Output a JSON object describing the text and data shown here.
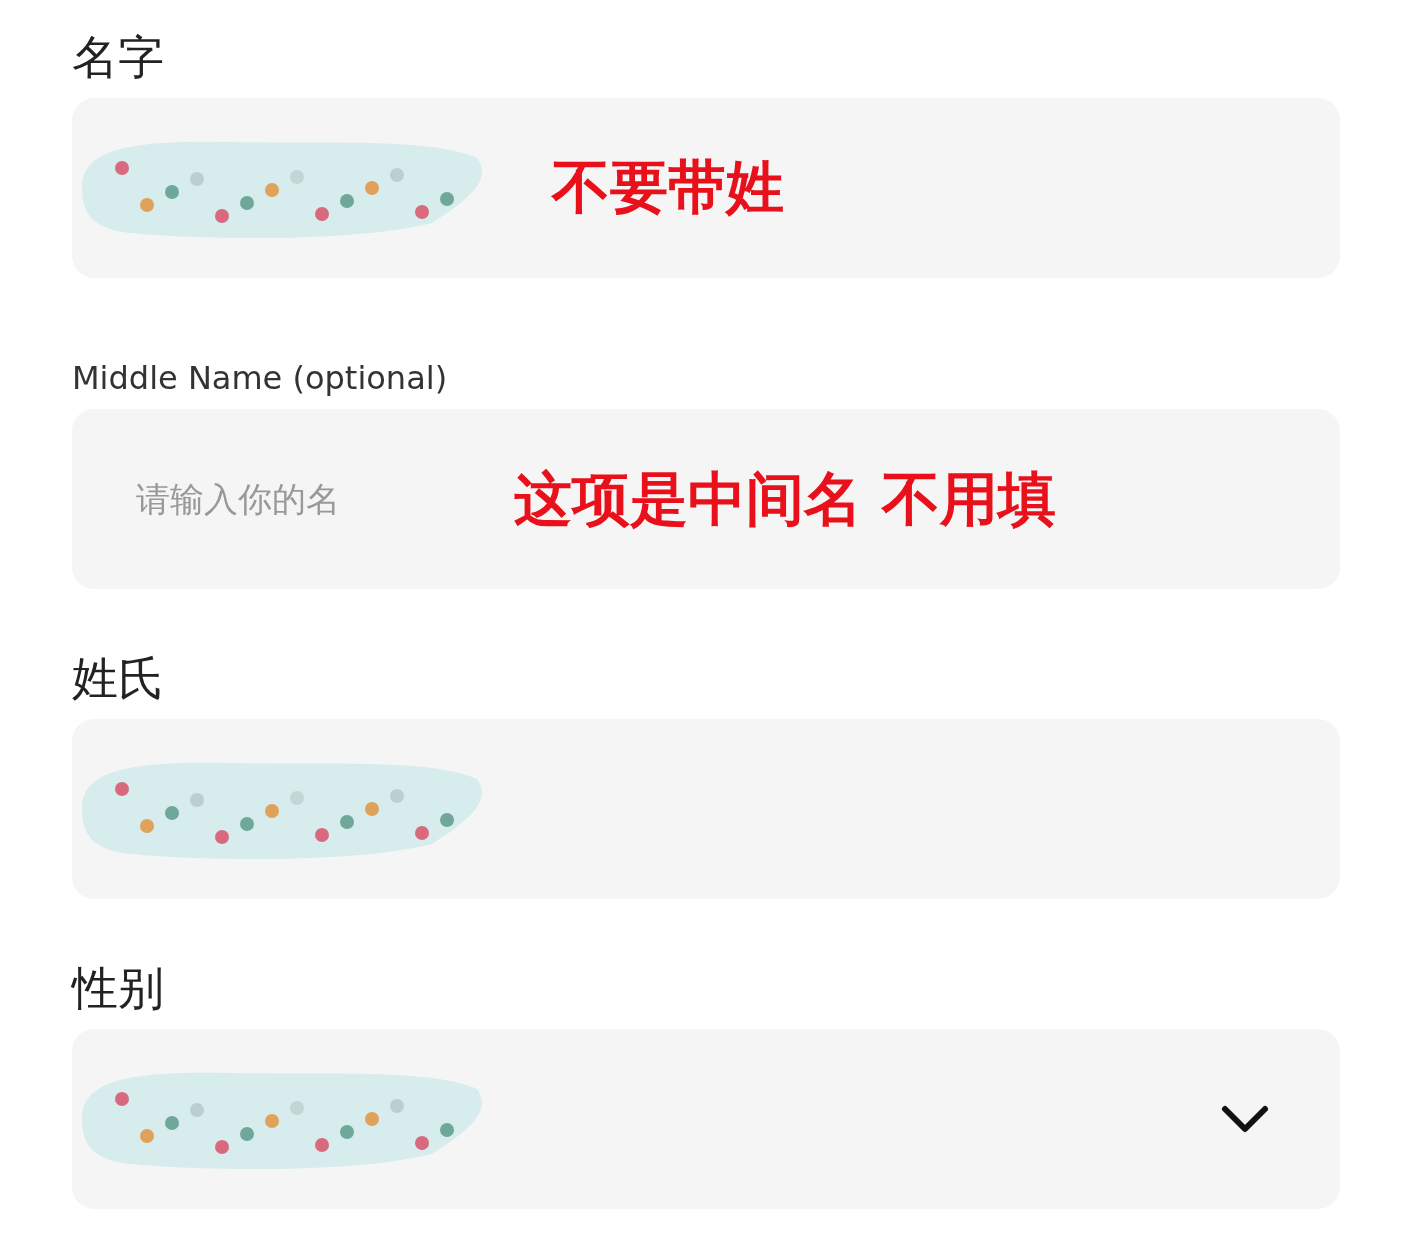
{
  "fields": [
    {
      "label": "名字",
      "small_label": false,
      "kind": "text",
      "redacted": true,
      "annotation": "不要带姓"
    },
    {
      "label": "Middle Name (optional)",
      "small_label": true,
      "kind": "text",
      "placeholder": "请输入你的名",
      "redacted": false,
      "annotation": "这项是中间名 不用填"
    },
    {
      "label": "姓氏",
      "small_label": false,
      "kind": "text",
      "redacted": true
    },
    {
      "label": "性别",
      "small_label": false,
      "kind": "select",
      "redacted": true
    }
  ]
}
